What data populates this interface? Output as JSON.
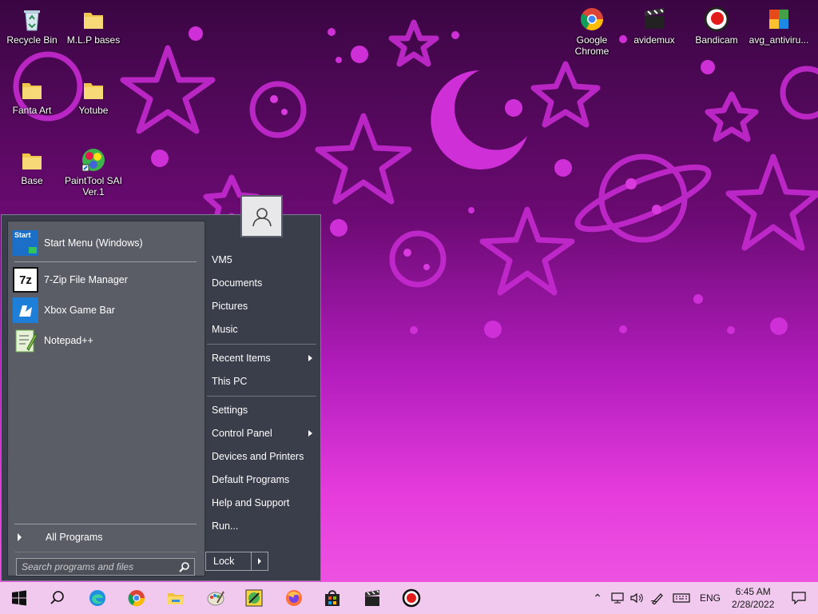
{
  "desktop": {
    "icons": [
      {
        "label": "Recycle Bin",
        "icon": "recycle-bin-icon"
      },
      {
        "label": "M.L.P bases",
        "icon": "folder-icon"
      },
      {
        "label": "Fanta Art",
        "icon": "folder-icon"
      },
      {
        "label": "Yotube",
        "icon": "folder-icon"
      },
      {
        "label": "Base",
        "icon": "folder-icon"
      },
      {
        "label": "PaintTool SAI Ver.1",
        "icon": "painttool-sai-icon"
      },
      {
        "label": "Google Chrome",
        "icon": "chrome-icon"
      },
      {
        "label": "avidemux",
        "icon": "avidemux-icon"
      },
      {
        "label": "Bandicam",
        "icon": "bandicam-icon"
      },
      {
        "label": "avg_antiviru...",
        "icon": "avg-antivirus-icon"
      }
    ]
  },
  "start_menu": {
    "pinned": [
      {
        "label": "Start Menu (Windows)",
        "icon": "start-menu-settings-icon"
      },
      {
        "label": "7-Zip File Manager",
        "icon": "7zip-icon"
      },
      {
        "label": "Xbox Game Bar",
        "icon": "xbox-game-bar-icon"
      },
      {
        "label": "Notepad++",
        "icon": "notepad-plus-plus-icon"
      }
    ],
    "all_programs": "All Programs",
    "search_placeholder": "Search programs and files",
    "right_items": {
      "vm5": "VM5",
      "documents": "Documents",
      "pictures": "Pictures",
      "music": "Music",
      "recent_items": "Recent Items",
      "this_pc": "This PC",
      "settings": "Settings",
      "control_panel": "Control Panel",
      "devices_printers": "Devices and Printers",
      "default_programs": "Default Programs",
      "help_support": "Help and Support",
      "run": "Run..."
    },
    "lock_label": "Lock",
    "start_icon_text": "Start"
  },
  "taskbar": {
    "apps": [
      "start-button-icon",
      "search-icon",
      "edge-icon",
      "chrome-icon",
      "file-explorer-icon",
      "paint-icon",
      "paint-tool-icon",
      "firefox-icon",
      "store-icon",
      "avidemux-icon",
      "bandicam-icon"
    ],
    "language": "ENG",
    "time": "6:45 AM",
    "date": "2/28/2022"
  },
  "colors": {
    "taskbar_bg": "#f1c8ee",
    "menu_bg": "#3a3d4a",
    "menu_left_bg": "#5a5d66",
    "wallpaper_shapes": "#d42fd9"
  }
}
